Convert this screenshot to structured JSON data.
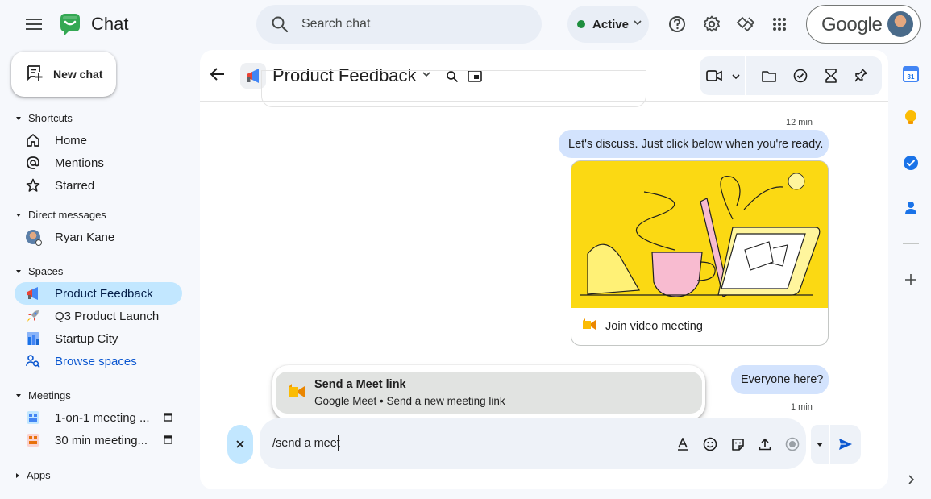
{
  "app": {
    "title": "Chat"
  },
  "search": {
    "placeholder": "Search chat"
  },
  "status": {
    "label": "Active",
    "color": "#1e8e3e"
  },
  "account": {
    "brand": "Google"
  },
  "colors": {
    "accent": "#0b57d0",
    "selected": "#c2e7ff",
    "bubble": "#d3e3fd",
    "meet_yellow": "#fbd913"
  },
  "nav": {
    "new_chat": "New chat",
    "shortcuts": {
      "heading": "Shortcuts",
      "items": [
        {
          "label": "Home",
          "icon": "home-icon"
        },
        {
          "label": "Mentions",
          "icon": "at-sign-icon"
        },
        {
          "label": "Starred",
          "icon": "star-icon"
        }
      ]
    },
    "direct_messages": {
      "heading": "Direct messages",
      "items": [
        {
          "label": "Ryan Kane",
          "icon": "avatar"
        }
      ]
    },
    "spaces": {
      "heading": "Spaces",
      "items": [
        {
          "label": "Product Feedback",
          "icon": "megaphone-icon",
          "selected": true
        },
        {
          "label": "Q3 Product Launch",
          "icon": "rocket-icon"
        },
        {
          "label": "Startup City",
          "icon": "city-icon"
        },
        {
          "label": "Browse spaces",
          "icon": "browse-spaces-icon"
        }
      ]
    },
    "meetings": {
      "heading": "Meetings",
      "items": [
        {
          "label": "1-on-1 meeting ...",
          "icon": "meeting-icon"
        },
        {
          "label": "30 min meeting...",
          "icon": "meeting-icon"
        }
      ]
    },
    "apps": {
      "heading": "Apps"
    }
  },
  "conversation": {
    "title": "Product Feedback",
    "messages": [
      {
        "time": "12 min",
        "text": "Let's discuss. Just click below when you're ready."
      },
      {
        "card_action": "Join video meeting"
      },
      {
        "time": "1 min",
        "text": "Everyone here?"
      }
    ]
  },
  "suggestion": {
    "title": "Send a Meet link",
    "subtitle": "Google Meet • Send a new meeting link"
  },
  "composer": {
    "value": "/send a meet"
  }
}
